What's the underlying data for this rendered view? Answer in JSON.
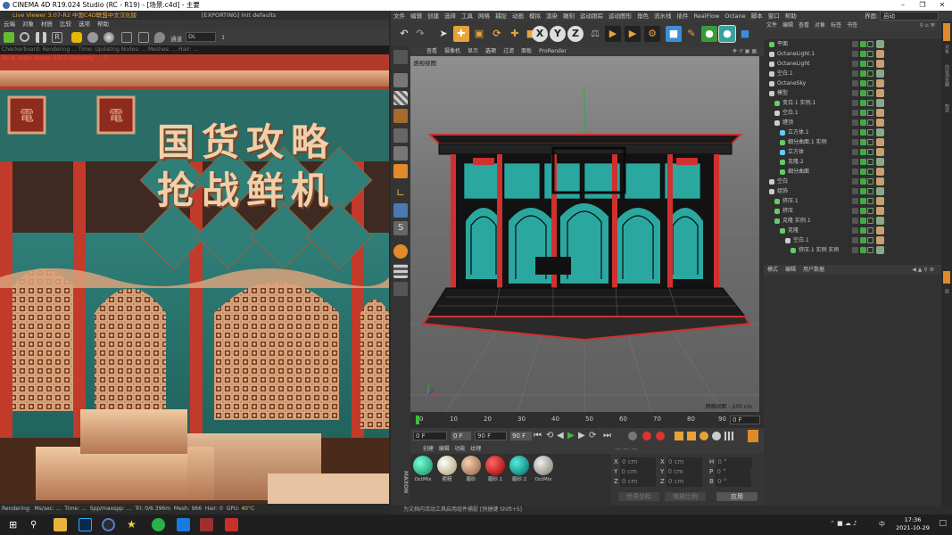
{
  "window": {
    "title": "CINEMA 4D R19.024 Studio (RC - R19) - [场景.c4d] - 主要"
  },
  "liveviewer": {
    "header": "Live Viewer 3.07-R2 中国C4D联盟中文汉化版",
    "exporting": "[EXPORTING] Init defaults",
    "menu": [
      "云端",
      "对象",
      "材质",
      "比较",
      "选项",
      "帮助"
    ],
    "channel_label": "通道",
    "channel_value": "DL",
    "channel_num": "1",
    "status_top": "Checkerboard: Rendering ...  Time: Updating  Nodes: ...  Meshes: ...  Hair: ...",
    "status_red": "Tri: 6.396m  Nodes: 1950  Updating: ...  7",
    "bottom": [
      "Rendering:",
      "Ms/sec: ...",
      "Time: ...",
      "Spp/maxspp: ...",
      "Tri: 0/6.396m",
      "Mesh: 966",
      "Hair: 0",
      "GPU:",
      "40°C"
    ],
    "render_text": [
      "国货攻略",
      "抢战鲜机"
    ],
    "plaque": [
      "電",
      "電"
    ]
  },
  "c4d": {
    "menu": [
      "文件",
      "编辑",
      "创建",
      "选择",
      "工具",
      "网格",
      "捕捉",
      "动画",
      "模拟",
      "渲染",
      "雕刻",
      "运动跟踪",
      "运动图形",
      "角色",
      "流水线",
      "插件",
      "RealFlow",
      "Octane",
      "脚本",
      "窗口",
      "帮助"
    ],
    "layout_label": "界面:",
    "layout_value": "启动",
    "toolbar_letters": [
      "X",
      "Y",
      "Z"
    ],
    "viewport_menu": [
      "查看",
      "摄像机",
      "显示",
      "选项",
      "过滤",
      "面板",
      "ProRender"
    ],
    "viewport_label": "透视视图",
    "grid_spacing": "网格间距 : 100 cm",
    "timeline_ticks": [
      "0",
      "10",
      "20",
      "30",
      "40",
      "50",
      "60",
      "70",
      "80",
      "90"
    ],
    "timeline_end": "0 F",
    "frame_start": "0 F",
    "frame_a": "0 F",
    "frame_end": "90 F",
    "frame_b": "90 F",
    "mat_menu": [
      "创建",
      "编辑",
      "功能",
      "纹理"
    ],
    "materials": [
      "OctMix",
      "粗糙",
      "磨砂",
      "磨砂.1",
      "磨砂.2",
      "OctMix"
    ],
    "coord_labels": [
      "X",
      "Y",
      "Z"
    ],
    "coord_values": [
      "0 cm",
      "0 cm",
      "0 cm"
    ],
    "coord_mid_labels": [
      "X",
      "Y",
      "Z"
    ],
    "coord_mid": [
      "0 cm",
      "0 cm",
      "0 cm"
    ],
    "coord_right_labels": [
      "H",
      "P",
      "B"
    ],
    "coord_right": [
      "0 °",
      "0 °",
      "0 °"
    ],
    "world_label": "世界坐标",
    "scale_label": "缩放比例",
    "apply_label": "应用",
    "status": "为文档内活动工具启用组件捕捉 [快捷键 Shift+S]"
  },
  "objects": {
    "menu": [
      "文件",
      "编辑",
      "查看",
      "对象",
      "标签",
      "书签"
    ],
    "rows": [
      {
        "name": "平面",
        "indent": 0,
        "color": "#6c6"
      },
      {
        "name": "OctaneLight.1",
        "indent": 0,
        "color": "#ccc"
      },
      {
        "name": "OctaneLight",
        "indent": 0,
        "color": "#ccc"
      },
      {
        "name": "空白.1",
        "indent": 0,
        "color": "#ccc"
      },
      {
        "name": "OctaneSky",
        "indent": 0,
        "color": "#ccc"
      },
      {
        "name": "模型",
        "indent": 0,
        "color": "#ccc"
      },
      {
        "name": "变白.1 实例.1",
        "indent": 1,
        "color": "#6c6"
      },
      {
        "name": "空白.1",
        "indent": 1,
        "color": "#ccc"
      },
      {
        "name": "缠顶",
        "indent": 1,
        "color": "#ccc"
      },
      {
        "name": "立方体.1",
        "indent": 2,
        "color": "#6cf"
      },
      {
        "name": "细分曲面.1 实例",
        "indent": 2,
        "color": "#6c6"
      },
      {
        "name": "立方体",
        "indent": 2,
        "color": "#6cf"
      },
      {
        "name": "克隆.2",
        "indent": 2,
        "color": "#6c6"
      },
      {
        "name": "细分曲面",
        "indent": 2,
        "color": "#6c6"
      },
      {
        "name": "空白",
        "indent": 0,
        "color": "#ccc"
      },
      {
        "name": "组饰",
        "indent": 0,
        "color": "#ccc"
      },
      {
        "name": "挤压.1",
        "indent": 1,
        "color": "#6c6"
      },
      {
        "name": "挤压",
        "indent": 1,
        "color": "#6c6"
      },
      {
        "name": "克隆 实例.1",
        "indent": 1,
        "color": "#6c6"
      },
      {
        "name": "克隆",
        "indent": 2,
        "color": "#6c6"
      },
      {
        "name": "空白.1",
        "indent": 3,
        "color": "#ccc"
      },
      {
        "name": "挤压.1 实例 实例",
        "indent": 4,
        "color": "#6c6"
      }
    ]
  },
  "attributes": {
    "menu": [
      "模式",
      "编辑",
      "用户数据"
    ]
  },
  "right_tabs": [
    "对象",
    "内容浏览器",
    "构造",
    "层"
  ],
  "taskbar": {
    "time": "17:36",
    "date": "2021-10-29",
    "ime": "中"
  }
}
